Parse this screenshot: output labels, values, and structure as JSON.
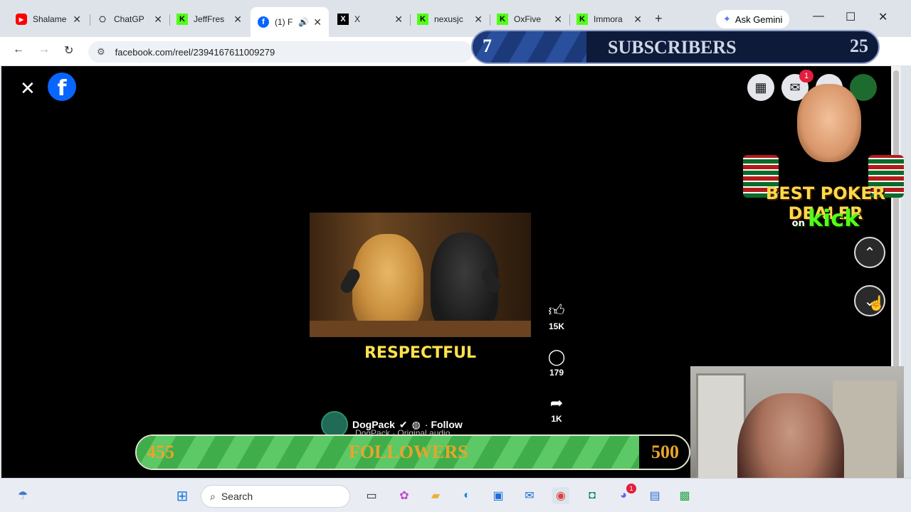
{
  "tabs": [
    {
      "title": "Shalame",
      "icon": "youtube-icon",
      "color": "#ff0000"
    },
    {
      "title": "ChatGP",
      "icon": "chatgpt-icon",
      "color": "#444444"
    },
    {
      "title": "JeffFres",
      "icon": "kick-icon",
      "color": "#53fc18"
    },
    {
      "title": "(1) F",
      "icon": "facebook-icon",
      "color": "#0866ff",
      "active": true
    },
    {
      "title": "X",
      "icon": "x-icon",
      "color": "#000000"
    },
    {
      "title": "nexusjc",
      "icon": "kick-icon",
      "color": "#53fc18"
    },
    {
      "title": "OxFive",
      "icon": "kick-icon",
      "color": "#53fc18"
    },
    {
      "title": "Immora",
      "icon": "kick-icon",
      "color": "#53fc18"
    }
  ],
  "browser": {
    "gemini_label": "Ask Gemini",
    "url": "facebook.com/reel/2394167611009279"
  },
  "subscribers": {
    "current": "7",
    "label": "SUBSCRIBERS",
    "goal": "25",
    "fraction": 0.28
  },
  "followers": {
    "current": "455",
    "label": "FOLLOWERS",
    "goal": "500",
    "fraction": 0.91
  },
  "reel": {
    "caption": "RESPECTFUL",
    "likes": "15K",
    "comments": "179",
    "shares": "1K",
    "author": "DogPack",
    "follow": "Follow",
    "audio": "DogPack · Original audio"
  },
  "fb": {
    "messenger_badge": "1"
  },
  "poker": {
    "title": "BEST POKER DEALER",
    "on": "on",
    "brand": "kick"
  },
  "taskbar": {
    "search_placeholder": "Search",
    "discord_badge": "1"
  }
}
